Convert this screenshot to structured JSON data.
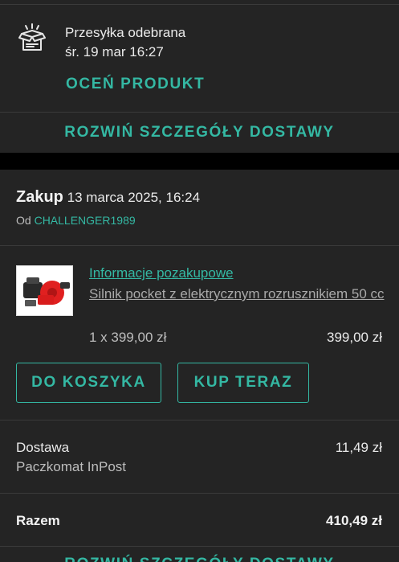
{
  "shipment": {
    "icon": "opened-package-icon",
    "status": "Przesyłka odebrana",
    "date": "śr. 19 mar 16:27",
    "rate_product": "OCEŃ PRODUKT",
    "expand_details": "ROZWIŃ SZCZEGÓŁY DOSTAWY"
  },
  "purchase": {
    "label": "Zakup",
    "date": "13 marca 2025, 16:24",
    "seller_prefix": "Od",
    "seller": "CHALLENGER1989"
  },
  "item": {
    "after_sale_link": "Informacje pozakupowe",
    "name": "Silnik pocket z elektrycznym rozrusznikiem 50 cc",
    "quantity_price": "1 x 399,00 zł",
    "total": "399,00 zł",
    "add_to_cart": "DO KOSZYKA",
    "buy_now": "KUP TERAZ"
  },
  "delivery": {
    "label": "Dostawa",
    "method": "Paczkomat InPost",
    "price": "11,49 zł"
  },
  "summary": {
    "label": "Razem",
    "total": "410,49 zł"
  },
  "footer": {
    "cutoff_label": "ROZWIŃ SZCZEGÓŁY DOSTAWY"
  },
  "colors": {
    "accent": "#34b8a3",
    "card": "#242424",
    "background": "#000000"
  }
}
